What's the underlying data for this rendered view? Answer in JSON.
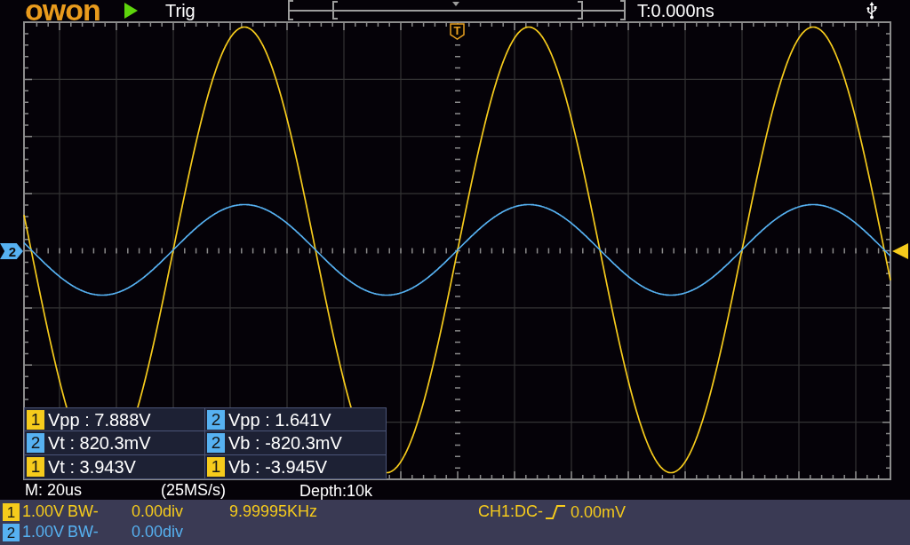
{
  "header": {
    "logo": "owon",
    "running": true,
    "status": "Trig",
    "time_offset": "T:0.000ns",
    "usb_connected": true
  },
  "display": {
    "trigger_position_label": "T",
    "channel_marker_label": "2"
  },
  "measurements": [
    {
      "channel": "1",
      "color": "#f6cb1c",
      "text": "Vpp : 7.888V"
    },
    {
      "channel": "2",
      "color": "#56b1f1",
      "text": "Vpp : 1.641V"
    },
    {
      "channel": "2",
      "color": "#56b1f1",
      "text": "Vt : 820.3mV"
    },
    {
      "channel": "2",
      "color": "#56b1f1",
      "text": "Vb : -820.3mV"
    },
    {
      "channel": "1",
      "color": "#f6cb1c",
      "text": "Vt : 3.943V"
    },
    {
      "channel": "1",
      "color": "#f6cb1c",
      "text": "Vb : -3.945V"
    }
  ],
  "timebase": {
    "scale": "M: 20us",
    "sample_rate": "(25MS/s)",
    "depth": "Depth:10k"
  },
  "channels": [
    {
      "number": "1",
      "color": "#f6cb1c",
      "scale": "1.00V",
      "bandwidth": "BW-",
      "offset": "0.00div",
      "frequency": "9.99995KHz"
    },
    {
      "number": "2",
      "color": "#56b1f1",
      "scale": "1.00V",
      "bandwidth": "BW-",
      "offset": "0.00div"
    }
  ],
  "trigger": {
    "source": "CH1:DC-",
    "rising_edge": true,
    "level": "0.00mV"
  }
}
